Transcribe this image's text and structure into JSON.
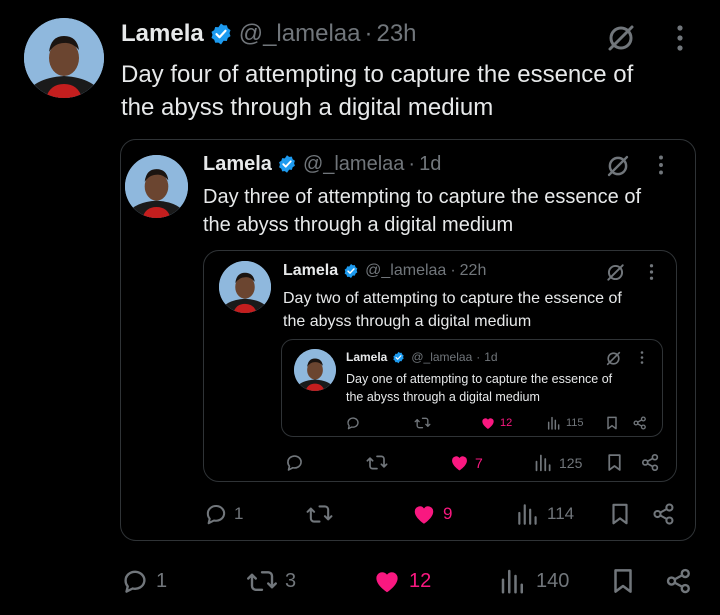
{
  "author": {
    "name": "Lamela",
    "handle": "@_lamelaa",
    "dot": "·"
  },
  "colors": {
    "background": "#000000",
    "text": "#e7e9ea",
    "muted": "#71767b",
    "verified": "#1d9bf0",
    "like": "#f91880",
    "border": "#2f3336"
  },
  "icons": [
    "verified-badge-icon",
    "grok-icon",
    "more-icon",
    "reply-icon",
    "retweet-icon",
    "heart-filled-icon",
    "views-icon",
    "bookmark-icon",
    "share-icon"
  ],
  "tweets": [
    {
      "time": "23h",
      "text_line1": "Day four of attempting to capture the essence of",
      "text_line2": "the abyss through a digital medium",
      "replies": "1",
      "retweets": "3",
      "likes": "12",
      "views": "140"
    },
    {
      "time": "1d",
      "text_line1": "Day three of attempting to capture the essence of",
      "text_line2": "the abyss through a digital medium",
      "replies": "1",
      "retweets": "",
      "likes": "9",
      "views": "114"
    },
    {
      "time": "22h",
      "text_line1": "Day two of attempting to capture the essence of",
      "text_line2": "the abyss through a digital medium",
      "replies": "",
      "retweets": "",
      "likes": "7",
      "views": "125"
    },
    {
      "time": "1d",
      "text_line1": "Day one of attempting to capture the essence of",
      "text_line2": "the abyss through a digital medium",
      "replies": "",
      "retweets": "",
      "likes": "12",
      "views": "115"
    }
  ]
}
